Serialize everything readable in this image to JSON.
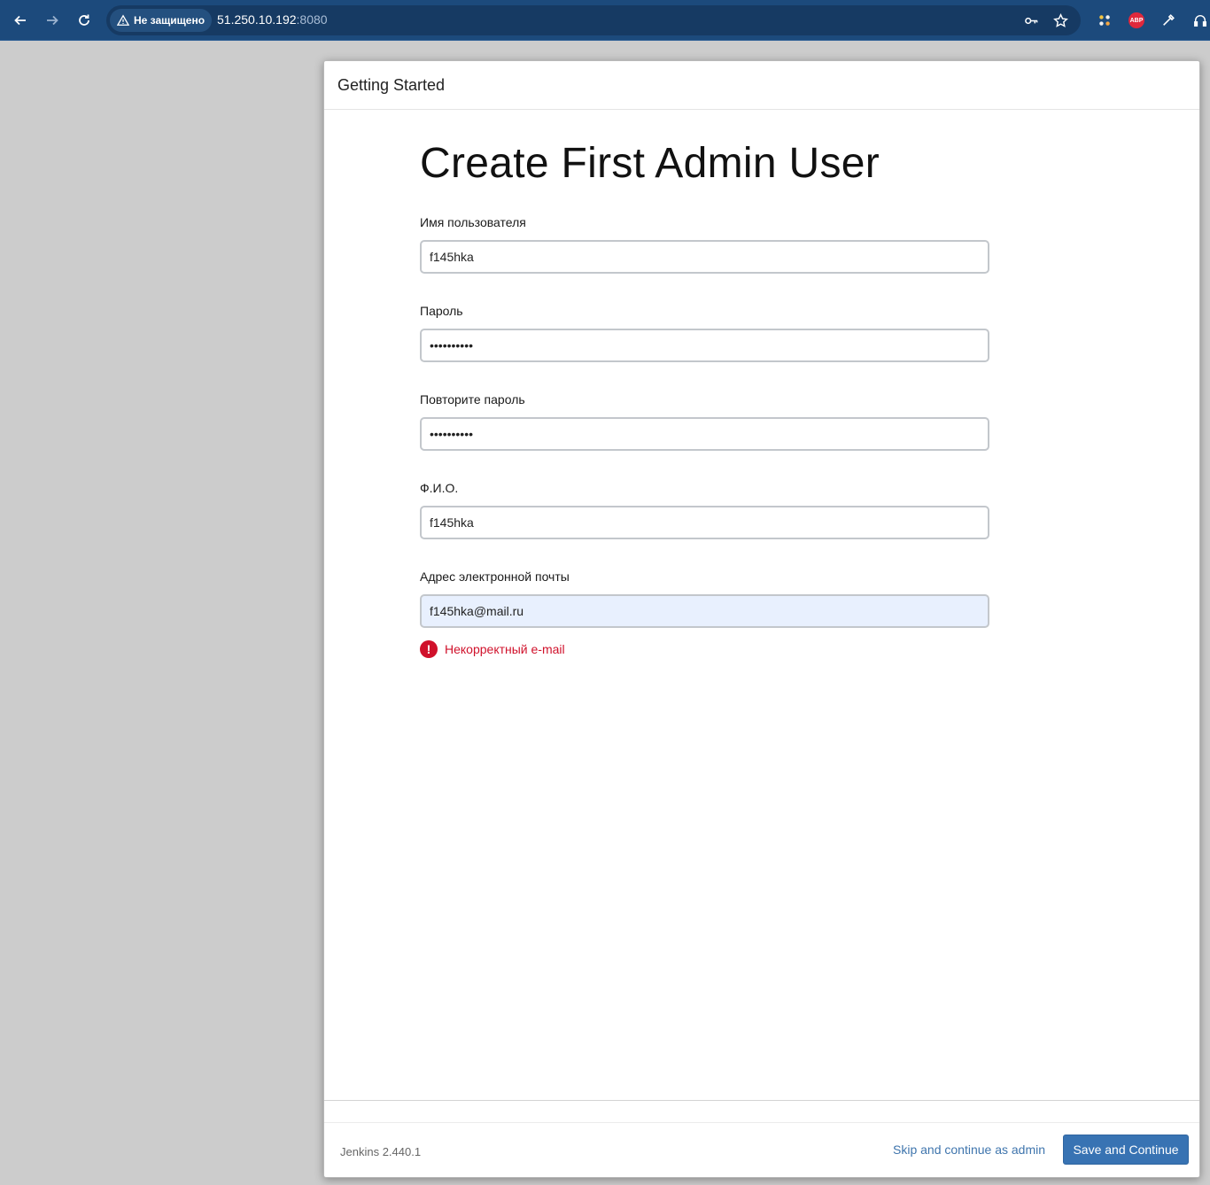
{
  "browser": {
    "security_label": "Не защищено",
    "url_host": "51.250.10.192",
    "url_port": ":8080",
    "extensions": {
      "abp_label": "ABP"
    }
  },
  "dialog": {
    "header_title": "Getting Started",
    "page_title": "Create First Admin User",
    "fields": [
      {
        "label": "Имя пользователя",
        "value": "f145hka",
        "type": "text"
      },
      {
        "label": "Пароль",
        "value": "••••••••••",
        "type": "password"
      },
      {
        "label": "Повторите пароль",
        "value": "••••••••••",
        "type": "password"
      },
      {
        "label": "Ф.И.О.",
        "value": "f145hka",
        "type": "text"
      },
      {
        "label": "Адрес электронной почты",
        "value": "f145hka@mail.ru",
        "type": "email"
      }
    ],
    "error_message": "Некорректный e-mail",
    "footer": {
      "version": "Jenkins 2.440.1",
      "skip_label": "Skip and continue as admin",
      "save_label": "Save and Continue"
    }
  },
  "colors": {
    "toolbar": "#1c4a7c",
    "primary_button": "#3873b3",
    "error": "#d0112b",
    "link": "#3f75ad"
  }
}
